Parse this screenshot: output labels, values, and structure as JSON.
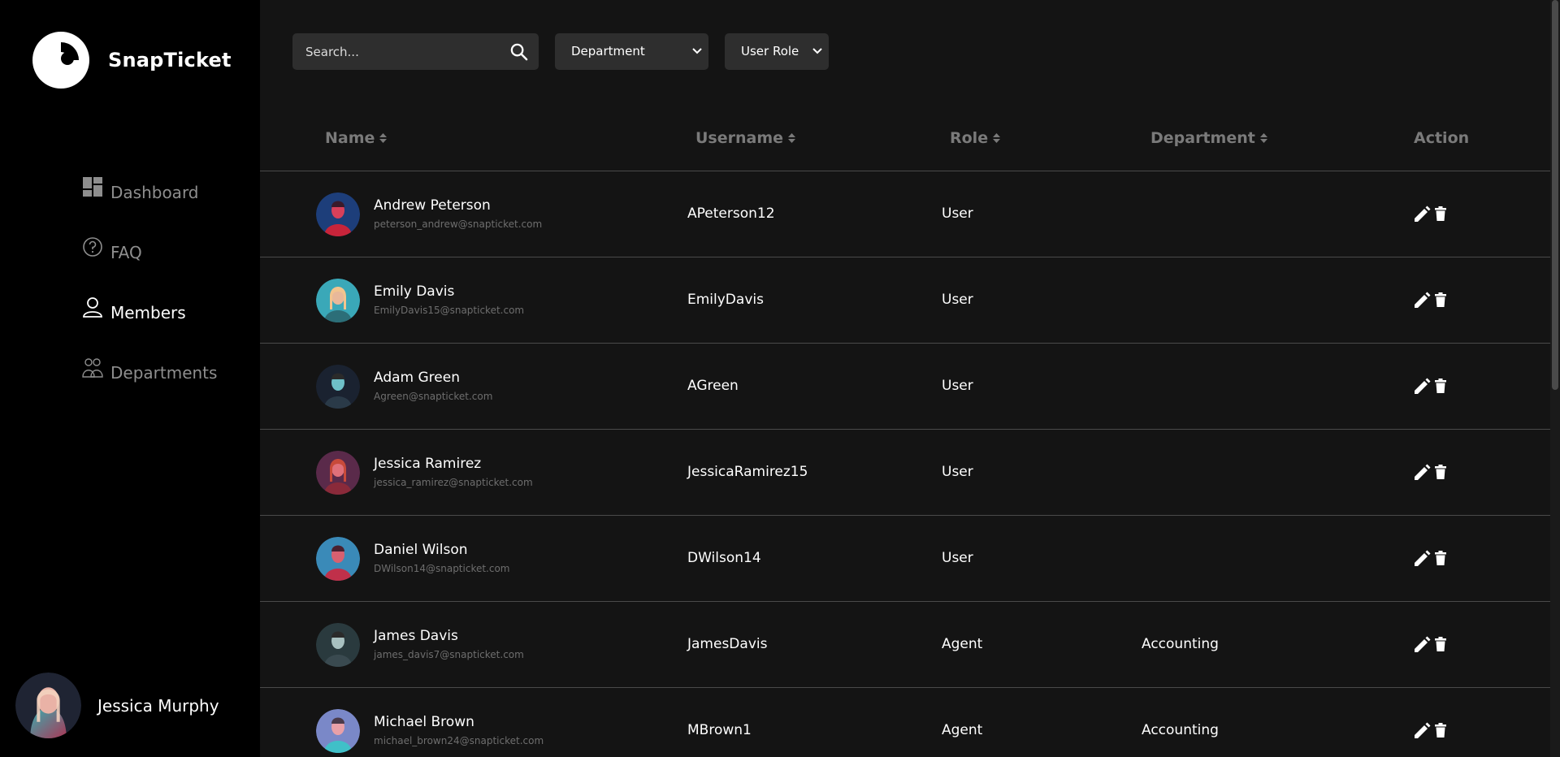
{
  "app": {
    "name": "SnapTicket",
    "accent": "#ffffff",
    "background": "#121212",
    "sidebar_background": "#000000"
  },
  "sidebar": {
    "items": [
      {
        "label": "Dashboard",
        "icon": "dashboard-icon",
        "active": false
      },
      {
        "label": "FAQ",
        "icon": "question-circle-icon",
        "active": false
      },
      {
        "label": "Members",
        "icon": "user-icon",
        "active": true
      },
      {
        "label": "Departments",
        "icon": "group-icon",
        "active": false
      }
    ],
    "profile": {
      "name": "Jessica Murphy",
      "icon": "avatar"
    }
  },
  "filters": {
    "search_placeholder": "Search...",
    "search_value": "",
    "department_select": "Department",
    "role_select": "User Role"
  },
  "table": {
    "columns": {
      "name": "Name",
      "username": "Username",
      "role": "Role",
      "department": "Department",
      "action": "Action"
    },
    "rows": [
      {
        "name": "Andrew Peterson",
        "email": "peterson_andrew@snapticket.com",
        "username": "APeterson12",
        "role": "User",
        "department": ""
      },
      {
        "name": "Emily Davis",
        "email": "EmilyDavis15@snapticket.com",
        "username": "EmilyDavis",
        "role": "User",
        "department": ""
      },
      {
        "name": "Adam Green",
        "email": "Agreen@snapticket.com",
        "username": "AGreen",
        "role": "User",
        "department": ""
      },
      {
        "name": "Jessica Ramirez",
        "email": "jessica_ramirez@snapticket.com",
        "username": "JessicaRamirez15",
        "role": "User",
        "department": ""
      },
      {
        "name": "Daniel Wilson",
        "email": "DWilson14@snapticket.com",
        "username": "DWilson14",
        "role": "User",
        "department": ""
      },
      {
        "name": "James Davis",
        "email": "james_davis7@snapticket.com",
        "username": "JamesDavis",
        "role": "Agent",
        "department": "Accounting"
      },
      {
        "name": "Michael Brown",
        "email": "michael_brown24@snapticket.com",
        "username": "MBrown1",
        "role": "Agent",
        "department": "Accounting"
      }
    ]
  }
}
